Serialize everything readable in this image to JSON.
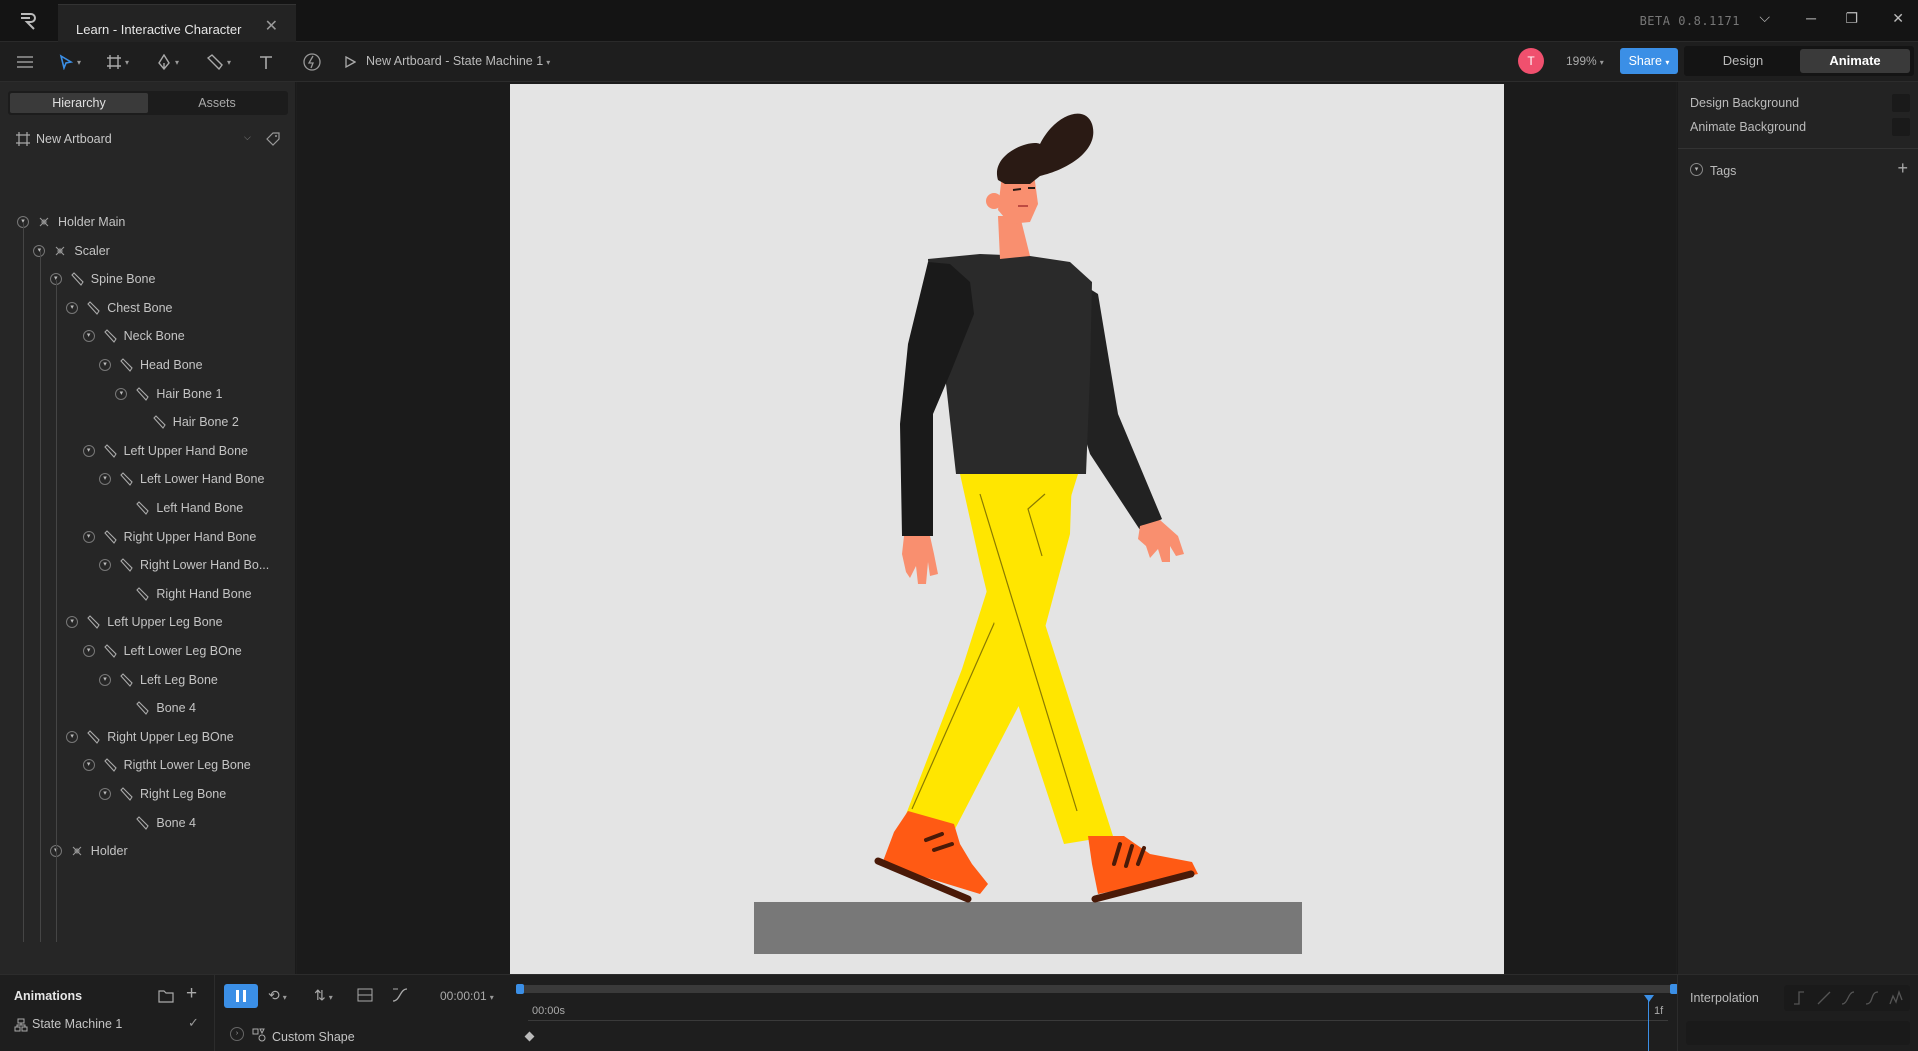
{
  "window": {
    "tab_title": "Learn - Interactive Character",
    "version": "BETA 0.8.1171"
  },
  "toolbar": {
    "state_machine_label": "New Artboard - State Machine 1",
    "avatar_initial": "T",
    "zoom": "199%",
    "share_label": "Share",
    "design_label": "Design",
    "animate_label": "Animate"
  },
  "left_panel": {
    "tabs": [
      "Hierarchy",
      "Assets"
    ],
    "artboard_name": "New Artboard",
    "tree": [
      {
        "label": "Holder Main",
        "depth": 0,
        "kind": "group",
        "toggle": true
      },
      {
        "label": "Scaler",
        "depth": 1,
        "kind": "group",
        "toggle": true
      },
      {
        "label": "Spine Bone",
        "depth": 2,
        "kind": "bone",
        "toggle": true
      },
      {
        "label": "Chest Bone",
        "depth": 3,
        "kind": "bone",
        "toggle": true
      },
      {
        "label": "Neck Bone",
        "depth": 4,
        "kind": "bone",
        "toggle": true
      },
      {
        "label": "Head Bone",
        "depth": 5,
        "kind": "bone",
        "toggle": true
      },
      {
        "label": "Hair Bone 1",
        "depth": 6,
        "kind": "bone",
        "toggle": true
      },
      {
        "label": "Hair Bone 2",
        "depth": 7,
        "kind": "bone",
        "toggle": false
      },
      {
        "label": "Left Upper Hand Bone",
        "depth": 4,
        "kind": "bone",
        "toggle": true
      },
      {
        "label": "Left Lower Hand Bone",
        "depth": 5,
        "kind": "bone",
        "toggle": true
      },
      {
        "label": "Left Hand Bone",
        "depth": 6,
        "kind": "bone",
        "toggle": false
      },
      {
        "label": "Right Upper Hand Bone",
        "depth": 4,
        "kind": "bone",
        "toggle": true
      },
      {
        "label": "Right Lower Hand Bo...",
        "depth": 5,
        "kind": "bone",
        "toggle": true
      },
      {
        "label": "Right Hand Bone",
        "depth": 6,
        "kind": "bone",
        "toggle": false
      },
      {
        "label": "Left Upper Leg Bone",
        "depth": 3,
        "kind": "bone",
        "toggle": true
      },
      {
        "label": "Left Lower Leg BOne",
        "depth": 4,
        "kind": "bone",
        "toggle": true
      },
      {
        "label": "Left Leg Bone",
        "depth": 5,
        "kind": "bone",
        "toggle": true
      },
      {
        "label": "Bone 4",
        "depth": 6,
        "kind": "bone",
        "toggle": false
      },
      {
        "label": "Right Upper Leg BOne",
        "depth": 3,
        "kind": "bone",
        "toggle": true
      },
      {
        "label": "Rigtht Lower Leg Bone",
        "depth": 4,
        "kind": "bone",
        "toggle": true
      },
      {
        "label": "Right Leg Bone",
        "depth": 5,
        "kind": "bone",
        "toggle": true
      },
      {
        "label": "Bone 4",
        "depth": 6,
        "kind": "bone",
        "toggle": false
      },
      {
        "label": "Holder",
        "depth": 2,
        "kind": "group",
        "toggle": true
      }
    ]
  },
  "right_panel": {
    "design_bg": "Design Background",
    "animate_bg": "Animate Background",
    "tags": "Tags"
  },
  "bottom": {
    "animations_title": "Animations",
    "state_machine": "State Machine 1",
    "timecode": "00:00:01",
    "time_start": "00:00s",
    "frame_marker": "1f",
    "layer": "Custom Shape",
    "interpolation": "Interpolation"
  },
  "colors": {
    "accent": "#3b8fe6",
    "avatar": "#f0506e",
    "pants": "#ffe600",
    "shirt": "#222222",
    "shoes": "#ff5a14",
    "skin": "#f98f6f",
    "hair": "#2a1a14",
    "ground": "#787878"
  }
}
